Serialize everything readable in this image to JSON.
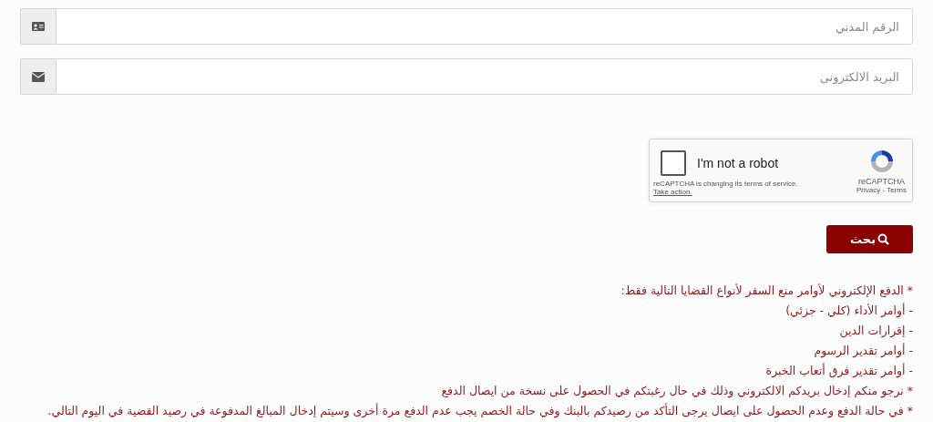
{
  "fields": [
    {
      "kind": "id",
      "placeholder": "الرقم المدني"
    },
    {
      "kind": "email",
      "placeholder": "البريد الالكترونى"
    }
  ],
  "captcha": {
    "label": "I'm not a robot",
    "checked": false,
    "notice": "reCAPTCHA is changing its terms of service.",
    "action": "Take action.",
    "brand": "reCAPTCHA",
    "links": "Privacy - Terms"
  },
  "search_button": {
    "label": "بحث"
  },
  "notes": [
    "* الدفع الإلكتروني لأوامر منع السفر لأنواع القضايا التالية فقط:",
    "- أوامر الأداء (كلي - جزئي)",
    "- إقرارات الدين",
    "- أوامر تقدير الرسوم",
    "- أوامر تقدير فرق أتعاب الخبرة",
    "* نرجو منكم إدخال بريدكم الالكتروني وذلك في حال رغبتكم في الحصول على نسخة من ايصال الدفع",
    "* في حالة الدفع وعدم الحصول على ايصال يرجى التأكد من رصيدكم بالبنك وفي حالة الخصم يجب عدم الدفع مرة أخرى وسيتم إدخال المبالغ المدفوعة في رصيد القضية في اليوم التالي."
  ]
}
